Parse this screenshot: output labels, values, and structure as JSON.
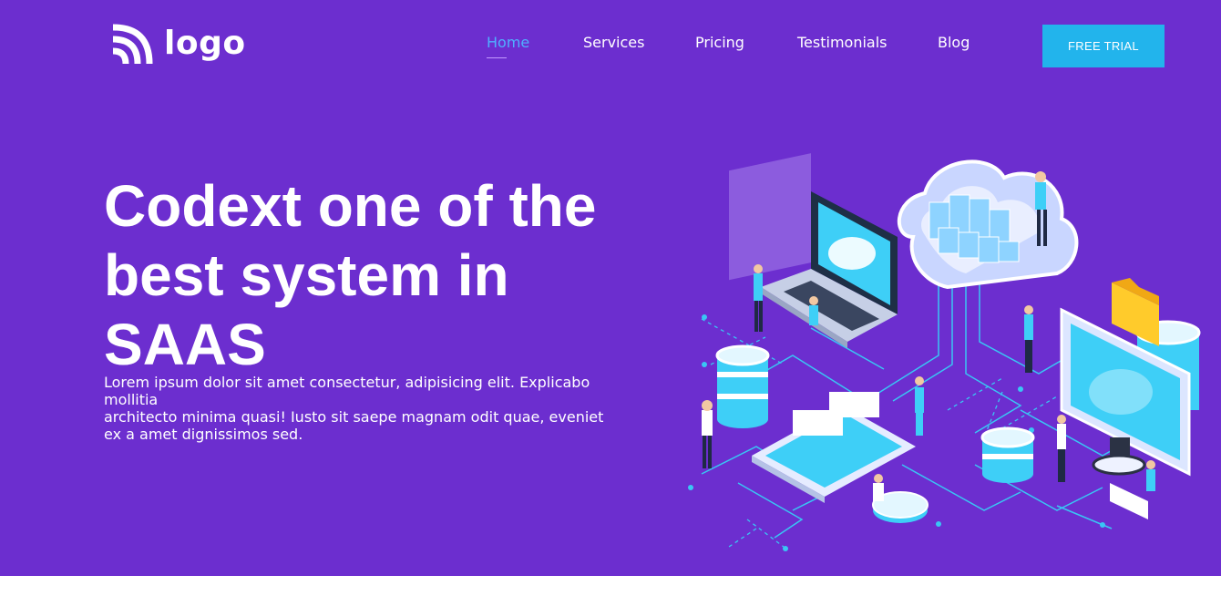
{
  "header": {
    "logo_text": "logo",
    "nav": [
      {
        "label": "Home",
        "active": true
      },
      {
        "label": "Services",
        "active": false
      },
      {
        "label": "Pricing",
        "active": false
      },
      {
        "label": "Testimonials",
        "active": false
      },
      {
        "label": "Blog",
        "active": false
      }
    ],
    "cta_label": "FREE TRIAL"
  },
  "hero": {
    "title_lines": [
      "Codext one of the",
      "best system in",
      "SAAS"
    ],
    "description_lines": [
      "Lorem ipsum dolor sit amet consectetur, adipisicing elit. Explicabo mollitia",
      "architecto minima quasi! Iusto sit saepe magnam odit quae, eveniet",
      "ex a amet dignissimos sed."
    ]
  },
  "colors": {
    "hero_background": "#6c2ecf",
    "accent": "#22b4ec",
    "active_nav": "#4fb0ff",
    "text": "#ffffff",
    "page_background": "#ffffff"
  },
  "icons": {
    "logo": "wifi-arcs-logo-icon",
    "illustration": "isometric-cloud-network-illustration"
  }
}
